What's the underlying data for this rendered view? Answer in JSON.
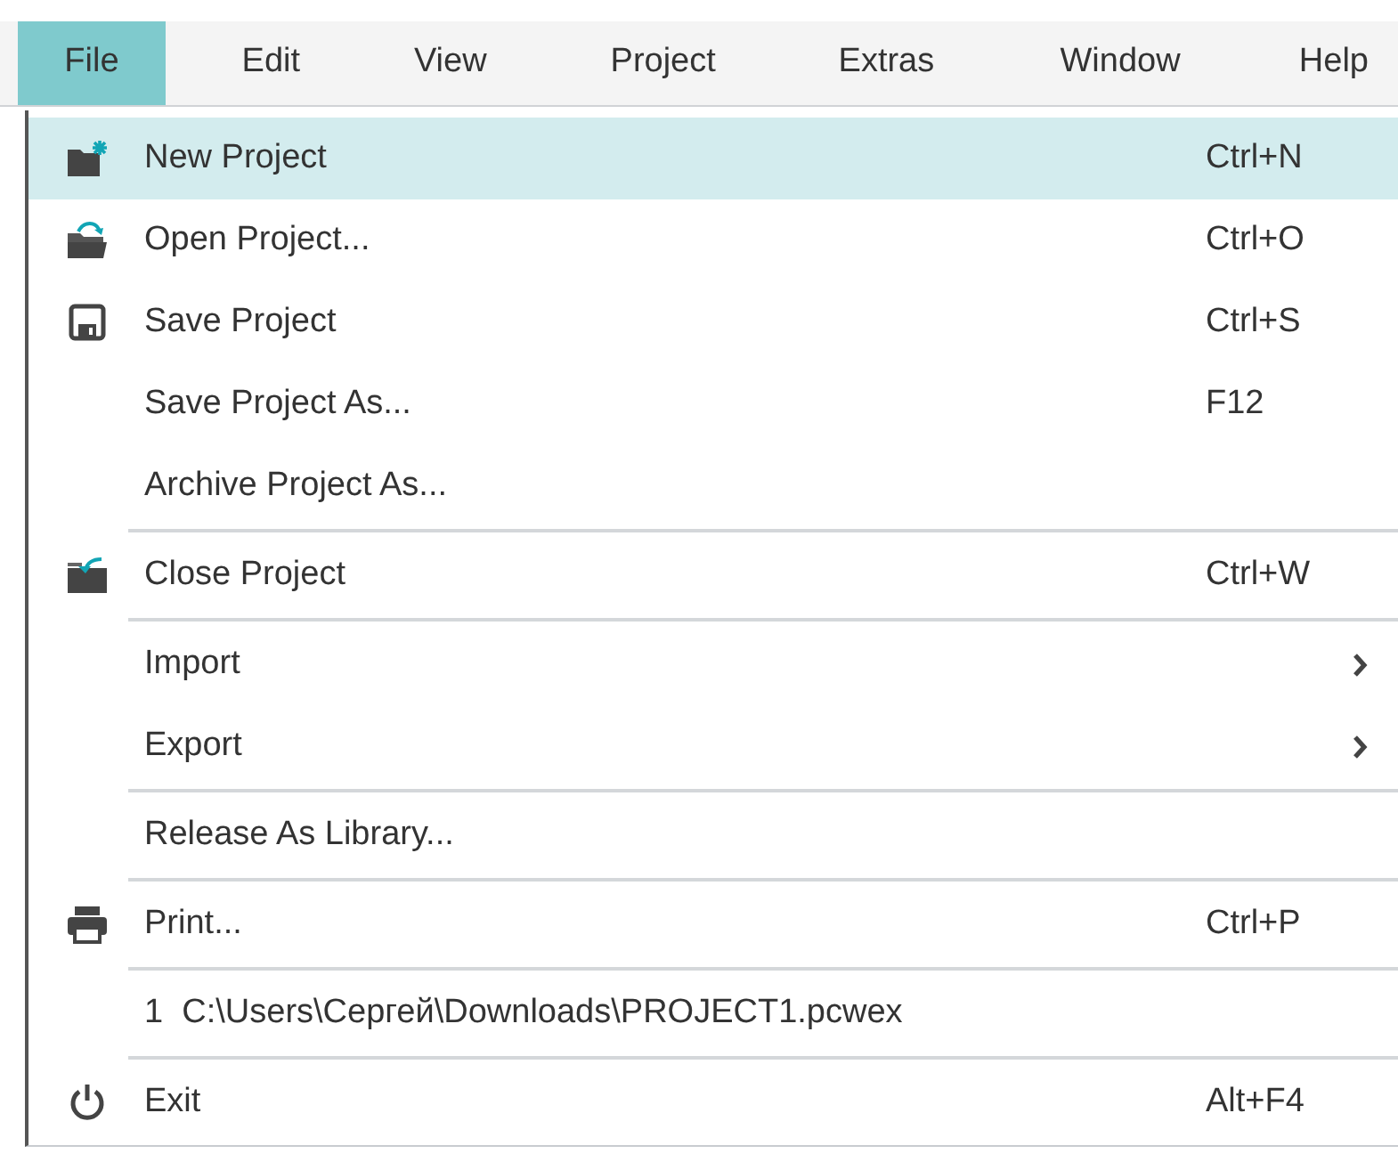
{
  "menu_bar": [
    {
      "label": "File",
      "selected": true
    },
    {
      "label": "Edit",
      "selected": false
    },
    {
      "label": "View",
      "selected": false
    },
    {
      "label": "Project",
      "selected": false
    },
    {
      "label": "Extras",
      "selected": false
    },
    {
      "label": "Window",
      "selected": false
    },
    {
      "label": "Help",
      "selected": false
    }
  ],
  "file_menu": [
    {
      "kind": "item",
      "label": "New Project",
      "shortcut": "Ctrl+N",
      "selected": true
    },
    {
      "kind": "item",
      "label": "Open Project...",
      "shortcut": "Ctrl+O",
      "selected": false
    },
    {
      "kind": "item",
      "label": "Save Project",
      "shortcut": "Ctrl+S",
      "selected": false
    },
    {
      "kind": "item",
      "label": "Save Project As...",
      "shortcut": "F12",
      "selected": false
    },
    {
      "kind": "item",
      "label": "Archive Project As...",
      "selected": false
    },
    {
      "kind": "separator"
    },
    {
      "kind": "item",
      "label": "Close Project",
      "shortcut": "Ctrl+W",
      "selected": false
    },
    {
      "kind": "separator"
    },
    {
      "kind": "item",
      "label": "Import",
      "submenu": true,
      "selected": false
    },
    {
      "kind": "item",
      "label": "Export",
      "submenu": true,
      "selected": false
    },
    {
      "kind": "separator"
    },
    {
      "kind": "item",
      "label": "Release As Library...",
      "selected": false
    },
    {
      "kind": "separator"
    },
    {
      "kind": "item",
      "label": "Print...",
      "shortcut": "Ctrl+P",
      "selected": false
    },
    {
      "kind": "separator"
    },
    {
      "kind": "item",
      "label": "1  C:\\Users\\Сергей\\Downloads\\PROJECT1.pcwex",
      "selected": false
    },
    {
      "kind": "separator"
    },
    {
      "kind": "item",
      "label": "Exit",
      "shortcut": "Alt+F4",
      "selected": false
    }
  ]
}
